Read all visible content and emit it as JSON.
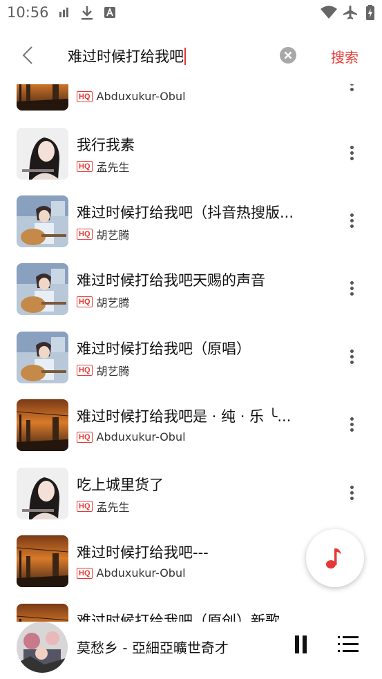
{
  "status_bar": {
    "time": "10:56"
  },
  "search": {
    "query": "难过时候打给我吧",
    "action_label": "搜索"
  },
  "badge_label": "HQ",
  "results": [
    {
      "title": "",
      "artist": "Abduxukur-Obul",
      "cover": "sunset"
    },
    {
      "title": "我行我素",
      "artist": "孟先生",
      "cover": "girl"
    },
    {
      "title": "难过时候打给我吧（抖音热搜版...",
      "artist": "胡艺腾",
      "cover": "guitar"
    },
    {
      "title": "难过时候打给我吧天赐的声音",
      "artist": "胡艺腾",
      "cover": "guitar"
    },
    {
      "title": "难过时候打给我吧（原唱）",
      "artist": "胡艺腾",
      "cover": "guitar"
    },
    {
      "title": "难过时候打给我吧是 · 纯 · 乐 ╰...",
      "artist": "Abduxukur-Obul",
      "cover": "sunset"
    },
    {
      "title": "吃上城里货了",
      "artist": "孟先生",
      "cover": "girl"
    },
    {
      "title": "难过时候打给我吧---",
      "artist": "Abduxukur-Obul",
      "cover": "sunset"
    },
    {
      "title": "难过时候打给我吧（原创）新歌",
      "artist": "",
      "cover": "sunset"
    }
  ],
  "player": {
    "now_playing": "莫愁乡 - 亞細亞曠世奇才"
  },
  "colors": {
    "accent": "#e53935"
  }
}
